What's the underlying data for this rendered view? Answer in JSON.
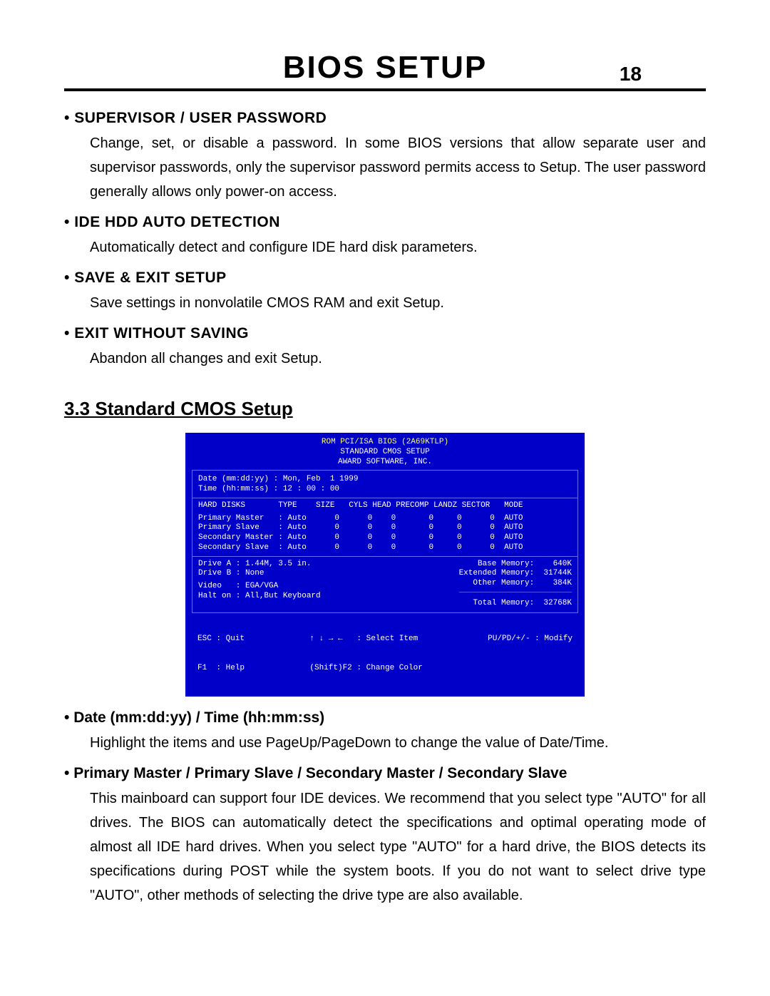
{
  "header": {
    "title": "BIOS SETUP",
    "page_number": "18"
  },
  "bullets": [
    {
      "title": "SUPERVISOR / USER PASSWORD",
      "text": "Change, set, or disable a password. In some BIOS versions that allow separate user and supervisor passwords, only the supervisor password permits access to Setup. The user password generally allows only power-on access."
    },
    {
      "title": "IDE HDD AUTO DETECTION",
      "text": "Automatically detect and configure IDE hard disk parameters."
    },
    {
      "title": "SAVE & EXIT SETUP",
      "text": "Save settings in nonvolatile CMOS RAM and exit Setup."
    },
    {
      "title": "EXIT WITHOUT SAVING",
      "text": "Abandon all changes and exit Setup."
    }
  ],
  "subsection": "3.3 Standard CMOS Setup",
  "bios": {
    "header1": "ROM PCI/ISA BIOS (2A69KTLP)",
    "header2": "STANDARD CMOS SETUP",
    "header3": "AWARD SOFTWARE, INC.",
    "date_line": "Date (mm:dd:yy) : Mon, Feb  1 1999",
    "time_line": "Time (hh:mm:ss) : 12 : 00 : 00",
    "disk_header": "HARD DISKS       TYPE    SIZE   CYLS HEAD PRECOMP LANDZ SECTOR   MODE",
    "disks": [
      "Primary Master   : Auto      0      0    0       0     0      0  AUTO",
      "Primary Slave    : Auto      0      0    0       0     0      0  AUTO",
      "Secondary Master : Auto      0      0    0       0     0      0  AUTO",
      "Secondary Slave  : Auto      0      0    0       0     0      0  AUTO"
    ],
    "drive_a": "Drive A : 1.44M, 3.5 in.",
    "drive_b": "Drive B : None",
    "video": "Video   : EGA/VGA",
    "halt": "Halt on : All,But Keyboard",
    "mem_base": "    Base Memory:    640K",
    "mem_ext": "Extended Memory:  31744K",
    "mem_other": "   Other Memory:    384K",
    "mem_sep": "────────────────────────",
    "mem_total": "   Total Memory:  32768K",
    "footer_left1": "ESC : Quit",
    "footer_left2": "F1  : Help",
    "footer_mid1": "↑ ↓ → ←   : Select Item",
    "footer_mid2": "(Shift)F2 : Change Color",
    "footer_right": "PU/PD/+/- : Modify"
  },
  "post_bullets": [
    {
      "title": "Date (mm:dd:yy) / Time (hh:mm:ss)",
      "text": "Highlight the items and use PageUp/PageDown to change the value of Date/Time."
    },
    {
      "title": "Primary Master / Primary Slave / Secondary Master / Secondary Slave",
      "text": "This mainboard can support four IDE devices.  We recommend that you select type \"AUTO\" for all drives. The BIOS can automatically detect the specifications and optimal operating mode of almost all IDE hard drives. When you select type \"AUTO\" for a hard drive, the BIOS detects its specifications during POST while the system boots. If you do not want to select drive type \"AUTO\", other methods of selecting the drive type are also available."
    }
  ]
}
